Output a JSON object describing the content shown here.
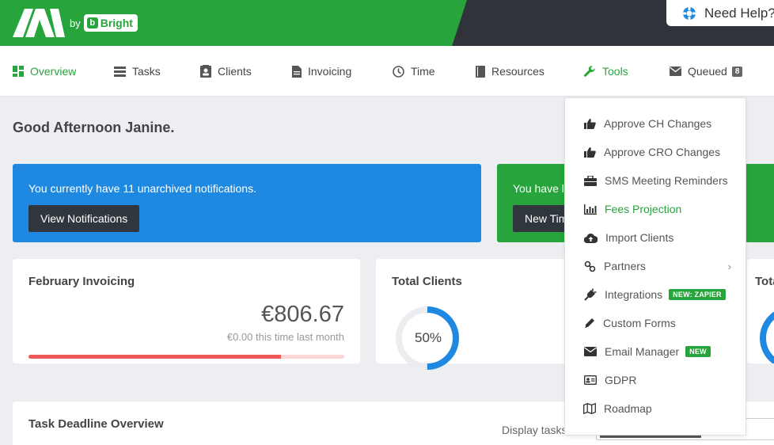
{
  "header": {
    "by_text": "by",
    "brand_text": "Bright",
    "help_label": "Need Help?"
  },
  "nav": {
    "items": [
      {
        "label": "Overview",
        "icon": "dashboard-icon"
      },
      {
        "label": "Tasks",
        "icon": "tasks-icon"
      },
      {
        "label": "Clients",
        "icon": "clients-icon"
      },
      {
        "label": "Invoicing",
        "icon": "invoice-icon"
      },
      {
        "label": "Time",
        "icon": "clock-icon"
      },
      {
        "label": "Resources",
        "icon": "book-icon"
      },
      {
        "label": "Tools",
        "icon": "wrench-icon"
      },
      {
        "label": "Queued",
        "icon": "envelope-icon",
        "badge": "8"
      }
    ]
  },
  "greeting": "Good Afternoon Janine.",
  "notifications": {
    "message": "You currently have 11 unarchived notifications.",
    "button": "View Notifications"
  },
  "green_banner": {
    "message": "You have l",
    "button": "New Tim"
  },
  "invoicing": {
    "title": "February Invoicing",
    "amount": "€806.67",
    "sub": "€0.00 this time last month",
    "progress": 0.8
  },
  "clients": {
    "title": "Total Clients",
    "donut_value": "50%",
    "fraction": 0.5
  },
  "third_card": {
    "title": "Tota"
  },
  "task_deadline": {
    "title": "Task Deadline Overview",
    "display_label": "Display tasks"
  },
  "tools_menu": [
    {
      "label": "Approve CH Changes",
      "icon": "thumbs-up-icon"
    },
    {
      "label": "Approve CRO Changes",
      "icon": "thumbs-up-icon"
    },
    {
      "label": "SMS Meeting Reminders",
      "icon": "briefcase-icon"
    },
    {
      "label": "Fees Projection",
      "icon": "bar-chart-icon"
    },
    {
      "label": "Import Clients",
      "icon": "cloud-upload-icon"
    },
    {
      "label": "Partners",
      "icon": "link-icon",
      "submenu": "›"
    },
    {
      "label": "Integrations",
      "icon": "plug-icon",
      "tag": "NEW: ZAPIER"
    },
    {
      "label": "Custom Forms",
      "icon": "pencil-icon"
    },
    {
      "label": "Email Manager",
      "icon": "envelope-icon",
      "tag": "NEW"
    },
    {
      "label": "GDPR",
      "icon": "id-card-icon"
    },
    {
      "label": "Roadmap",
      "icon": "map-icon"
    }
  ],
  "colors": {
    "green": "#27a53c",
    "dark": "#30333a",
    "blue": "#1f89e1",
    "red": "#ef5a58"
  }
}
